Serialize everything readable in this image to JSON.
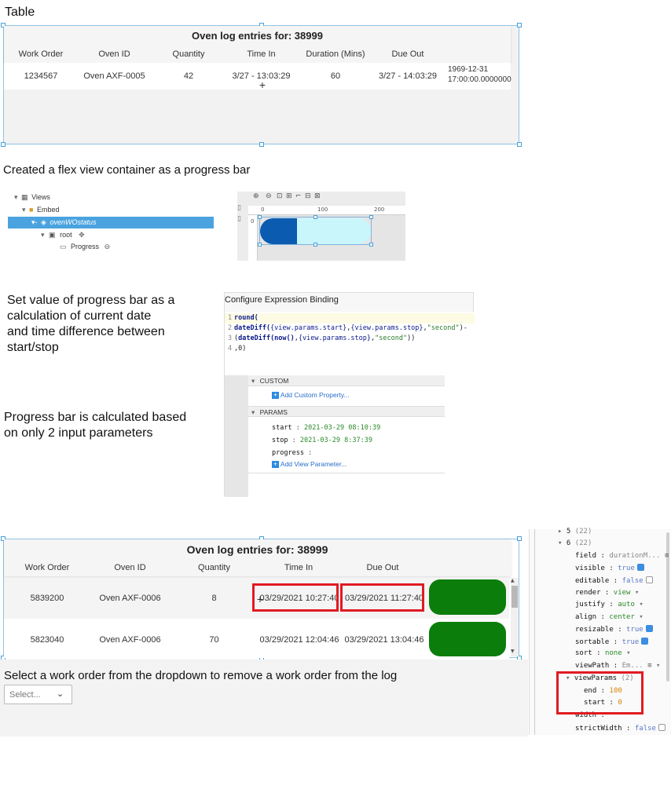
{
  "captions": {
    "table": "Table",
    "flex": "Created a flex view container as a progress bar",
    "set_value": [
      "Set value of progress bar as a",
      "calculation of current date",
      "and time difference between",
      "start/stop"
    ],
    "progress_calc": [
      "Progress bar is calculated based",
      "on only 2 input parameters"
    ],
    "select_hint": "Select a work order from the dropdown to remove a work order from the log"
  },
  "table1": {
    "title": "Oven log entries for: 38999",
    "headers": [
      "Work Order",
      "Oven ID",
      "Quantity",
      "Time In",
      "Duration (Mins)",
      "Due Out"
    ],
    "row": [
      "1234567",
      "Oven AXF-0005",
      "42",
      "3/27 - 13:03:29",
      "60",
      "3/27 - 14:03:29"
    ],
    "extra_line1": "1969-12-31",
    "extra_line2": "17:00:00.0000000"
  },
  "tree": {
    "views": "Views",
    "embed": "Embed",
    "selected": "ovenWOstatus",
    "root": "root",
    "progress": "Progress"
  },
  "canvas": {
    "ruler_0": "0",
    "ruler_100": "100",
    "ruler_200": "200",
    "ruler_v0": "0",
    "progress_fill": 0.33,
    "fill_color": "#0b5cb0",
    "track_color": "#c9f6fb"
  },
  "expression": {
    "title": "Configure Expression Binding",
    "lines": [
      {
        "n": "1",
        "parts": [
          {
            "t": "round(",
            "c": "kw"
          }
        ]
      },
      {
        "n": "2",
        "parts": [
          {
            "t": "dateDiff(",
            "c": "kw"
          },
          {
            "t": "{view.params.start}",
            "c": "prop"
          },
          {
            "t": ",",
            "c": ""
          },
          {
            "t": "{view.params.stop}",
            "c": "prop"
          },
          {
            "t": ",",
            "c": ""
          },
          {
            "t": "\"second\"",
            "c": "str"
          },
          {
            "t": ")-",
            "c": ""
          }
        ]
      },
      {
        "n": "3",
        "parts": [
          {
            "t": "(",
            "c": ""
          },
          {
            "t": "dateDiff(now()",
            "c": "kw"
          },
          {
            "t": ",",
            "c": ""
          },
          {
            "t": "{view.params.stop}",
            "c": "prop"
          },
          {
            "t": ",",
            "c": ""
          },
          {
            "t": "\"second\"",
            "c": "str"
          },
          {
            "t": "))",
            "c": ""
          }
        ]
      },
      {
        "n": "4",
        "parts": [
          {
            "t": ",0)",
            "c": ""
          }
        ]
      }
    ],
    "custom_label": "CUSTOM",
    "add_custom": "Add Custom Property...",
    "params_label": "PARAMS",
    "start_key": "start",
    "start_val": "2021-03-29 08:10:39",
    "stop_key": "stop",
    "stop_val": "2021-03-29 8:37:39",
    "progress_key": "progress",
    "add_param": "Add View Parameter..."
  },
  "table2": {
    "title": "Oven log entries for: 38999",
    "headers": [
      "Work Order",
      "Oven ID",
      "Quantity",
      "Time In",
      "Due Out"
    ],
    "rows": [
      [
        "5839200",
        "Oven AXF-0006",
        "8",
        "03/29/2021 10:27:40",
        "03/29/2021 11:27:40"
      ],
      [
        "5823040",
        "Oven AXF-0006",
        "70",
        "03/29/2021 12:04:46",
        "03/29/2021 13:04:46"
      ]
    ],
    "status_color": "#0b7d0b"
  },
  "dropdown": {
    "placeholder": "Select..."
  },
  "props": {
    "item5": "5",
    "item5_count": "(22)",
    "item6": "6",
    "item6_count": "(22)",
    "field_k": "field",
    "field_v": "durationM...",
    "visible_k": "visible",
    "visible_v": "true",
    "editable_k": "editable",
    "editable_v": "false",
    "render_k": "render",
    "render_v": "view",
    "justify_k": "justify",
    "justify_v": "auto",
    "align_k": "align",
    "align_v": "center",
    "resizable_k": "resizable",
    "resizable_v": "true",
    "sortable_k": "sortable",
    "sortable_v": "true",
    "sort_k": "sort",
    "sort_v": "none",
    "viewPath_k": "viewPath",
    "viewPath_v": "Em...",
    "viewParams_k": "viewParams",
    "viewParams_count": "(2)",
    "end_k": "end",
    "end_v": "100",
    "start_k": "start",
    "start_v": "0",
    "width_k": "width",
    "strictWidth_k": "strictWidth",
    "strictWidth_v": "false"
  }
}
